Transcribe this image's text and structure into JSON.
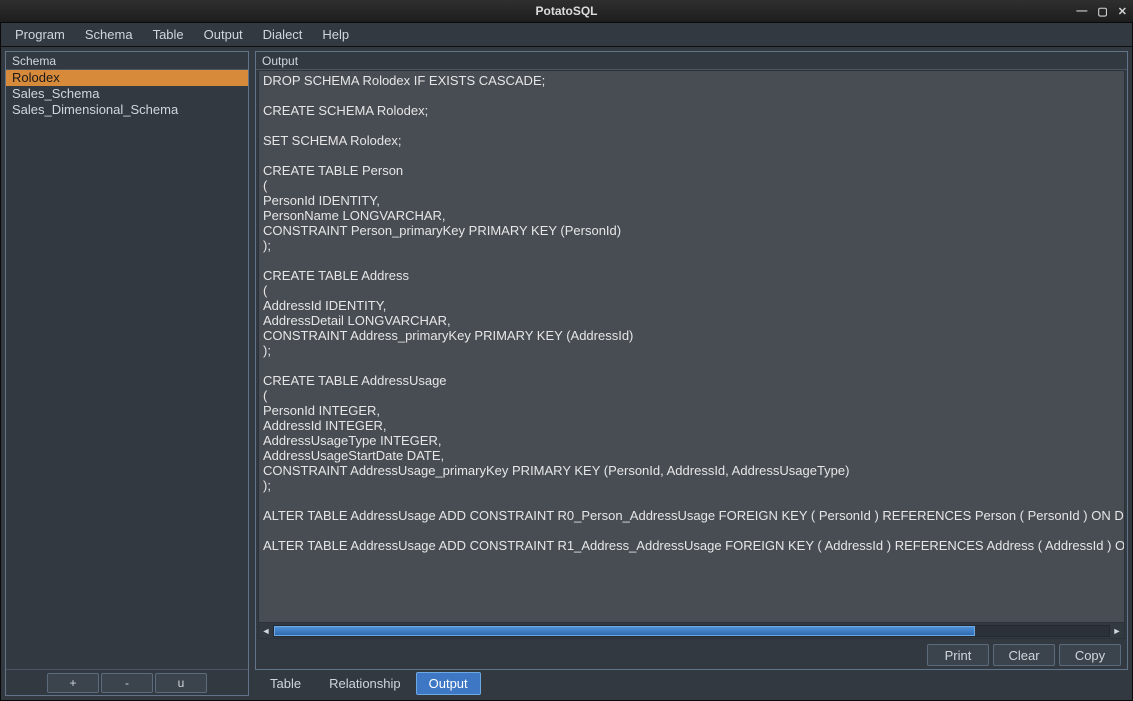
{
  "window": {
    "title": "PotatoSQL"
  },
  "menubar": {
    "items": [
      "Program",
      "Schema",
      "Table",
      "Output",
      "Dialect",
      "Help"
    ]
  },
  "sidebar": {
    "header": "Schema",
    "items": [
      {
        "label": "Rolodex",
        "selected": true
      },
      {
        "label": "Sales_Schema",
        "selected": false
      },
      {
        "label": "Sales_Dimensional_Schema",
        "selected": false
      }
    ],
    "buttons": {
      "add": "+",
      "remove": "-",
      "update": "u"
    }
  },
  "output": {
    "header": "Output",
    "text": "DROP SCHEMA Rolodex IF EXISTS CASCADE;\n\nCREATE SCHEMA Rolodex;\n\nSET SCHEMA Rolodex;\n\nCREATE TABLE Person\n(\nPersonId IDENTITY,\nPersonName LONGVARCHAR,\nCONSTRAINT Person_primaryKey PRIMARY KEY (PersonId)\n);\n\nCREATE TABLE Address\n(\nAddressId IDENTITY,\nAddressDetail LONGVARCHAR,\nCONSTRAINT Address_primaryKey PRIMARY KEY (AddressId)\n);\n\nCREATE TABLE AddressUsage\n(\nPersonId INTEGER,\nAddressId INTEGER,\nAddressUsageType INTEGER,\nAddressUsageStartDate DATE,\nCONSTRAINT AddressUsage_primaryKey PRIMARY KEY (PersonId, AddressId, AddressUsageType)\n);\n\nALTER TABLE AddressUsage ADD CONSTRAINT R0_Person_AddressUsage FOREIGN KEY ( PersonId ) REFERENCES Person ( PersonId ) ON DE\n\nALTER TABLE AddressUsage ADD CONSTRAINT R1_Address_AddressUsage FOREIGN KEY ( AddressId ) REFERENCES Address ( AddressId ) O",
    "buttons": {
      "print": "Print",
      "clear": "Clear",
      "copy": "Copy"
    }
  },
  "tabs": {
    "items": [
      {
        "label": "Table",
        "active": false
      },
      {
        "label": "Relationship",
        "active": false
      },
      {
        "label": "Output",
        "active": true
      }
    ]
  }
}
